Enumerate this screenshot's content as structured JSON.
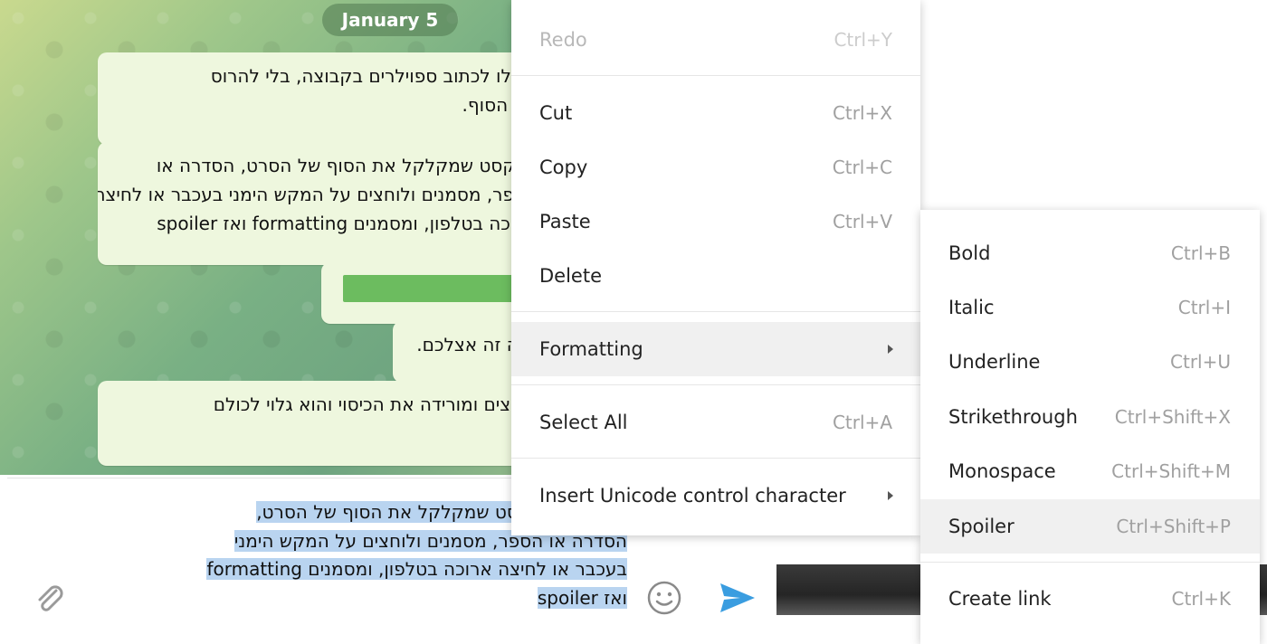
{
  "chat": {
    "date_label": "January 5",
    "messages": [
      {
        "lines": [
          "תוכלו לכתוב ספוילרים בקבוצה, בלי להרוס",
          "את הסוף."
        ]
      },
      {
        "lines": [
          "בטקסט שמקלקל את הסוף של הסרט, הסדרה או",
          "הספר, מסמנים ולוחצים על המקש הימני בעכבר או  לחיצה",
          "ארוכה בטלפון, ומסמנים formatting ואז spoiler"
        ]
      },
      {
        "lines": [
          ""
        ]
      },
      {
        "lines": [
          "ככה זה אצלכם."
        ]
      },
      {
        "lines": [
          "לוחצים ומורידה את הכיסוי והוא גלוי לכולם"
        ]
      }
    ]
  },
  "composer": {
    "lines": [
      "כתבו את הטקסט שמקלקל את הסוף של הסרט,",
      "הסדרה או הספר, מסמנים ולוחצים על המקש הימני",
      "בעכבר או  לחיצה ארוכה בטלפון, ומסמנים formatting",
      "ואז spoiler"
    ]
  },
  "context_menu": {
    "items": [
      {
        "label": "Redo",
        "shortcut": "Ctrl+Y"
      },
      {
        "label": "Cut",
        "shortcut": "Ctrl+X"
      },
      {
        "label": "Copy",
        "shortcut": "Ctrl+C"
      },
      {
        "label": "Paste",
        "shortcut": "Ctrl+V"
      },
      {
        "label": "Delete",
        "shortcut": ""
      },
      {
        "label": "Formatting",
        "shortcut": ""
      },
      {
        "label": "Select All",
        "shortcut": "Ctrl+A"
      },
      {
        "label": "Insert Unicode control character",
        "shortcut": ""
      }
    ]
  },
  "formatting_submenu": {
    "items": [
      {
        "label": "Bold",
        "shortcut": "Ctrl+B"
      },
      {
        "label": "Italic",
        "shortcut": "Ctrl+I"
      },
      {
        "label": "Underline",
        "shortcut": "Ctrl+U"
      },
      {
        "label": "Strikethrough",
        "shortcut": "Ctrl+Shift+X"
      },
      {
        "label": "Monospace",
        "shortcut": "Ctrl+Shift+M"
      },
      {
        "label": "Spoiler",
        "shortcut": "Ctrl+Shift+P"
      },
      {
        "label": "Create link",
        "shortcut": "Ctrl+K"
      }
    ]
  },
  "colors": {
    "bubble": "#eef7de",
    "selection": "#b9d4f0",
    "send_accent": "#3a9de0",
    "menu_hover": "#f0f0f0"
  }
}
